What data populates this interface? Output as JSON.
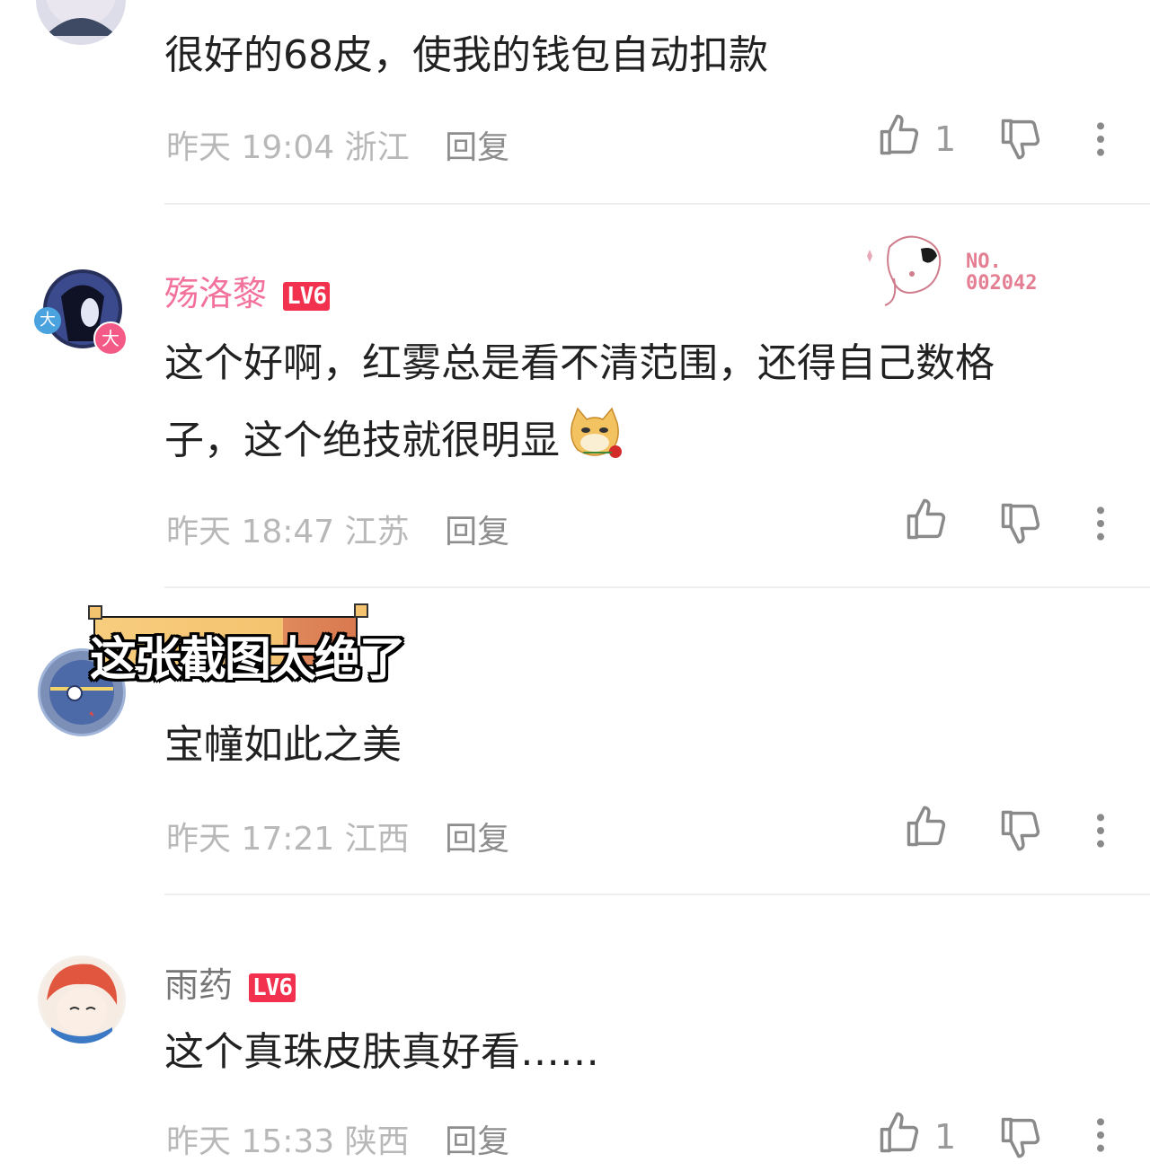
{
  "colors": {
    "level_badge": "#f2314e",
    "username_pink": "#f3729c",
    "username_gray": "#757575",
    "meta_gray": "#b8b8b8",
    "caption_orange": "#f5c977"
  },
  "comments": [
    {
      "text": "很好的68皮，使我的钱包自动扣款",
      "time": "昨天 19:04",
      "region": "浙江",
      "reply": "回复",
      "likes": "1"
    },
    {
      "username": "殇洛黎",
      "level": "LV6",
      "fan_badge": {
        "no": "NO.",
        "num": "002042"
      },
      "lines": [
        "这个好啊，红雾总是看不清范围，还得自己数格",
        "子，这个绝技就很明显"
      ],
      "emoji": "doge-rose-emoji",
      "time": "昨天 18:47",
      "region": "江苏",
      "reply": "回复",
      "avatar_badges": [
        "大",
        "大"
      ]
    },
    {
      "text": "宝幢如此之美",
      "time": "昨天 17:21",
      "region": "江西",
      "reply": "回复"
    },
    {
      "username": "雨药",
      "level": "LV6",
      "text": "这个真珠皮肤真好看……",
      "time": "昨天 15:33",
      "region": "陕西",
      "reply": "回复",
      "likes": "1"
    }
  ],
  "caption": "这张截图太绝了",
  "icons": {
    "like": "thumb-up-icon",
    "dislike": "thumb-down-icon",
    "more": "more-vertical-icon"
  }
}
